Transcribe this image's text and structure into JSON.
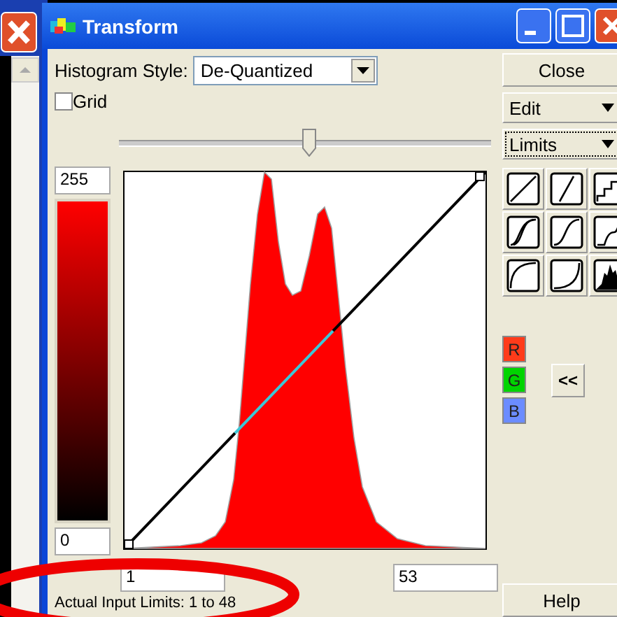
{
  "window": {
    "title": "Transform"
  },
  "histogram_style": {
    "label": "Histogram Style:",
    "value": "De-Quantized"
  },
  "grid": {
    "label": "Grid",
    "checked": false
  },
  "slider": {
    "level": 0.51
  },
  "output_max": "255",
  "output_min": "0",
  "input_min": "1",
  "input_max": "53",
  "status": "Actual Input Limits: 1 to 48",
  "close": "Close",
  "menus": [
    {
      "label": "Edit",
      "focused": false
    },
    {
      "label": "Limits",
      "focused": true
    }
  ],
  "presets": [
    {
      "kind": "linear"
    },
    {
      "kind": "steep"
    },
    {
      "kind": "steps"
    },
    {
      "kind": "s-curve"
    },
    {
      "kind": "s-soft"
    },
    {
      "kind": "step-curve"
    },
    {
      "kind": "log"
    },
    {
      "kind": "exp"
    },
    {
      "kind": "histogram"
    }
  ],
  "channels": [
    {
      "label": "R",
      "color": "#ff3b1a"
    },
    {
      "label": "G",
      "color": "#00d400"
    },
    {
      "label": "B",
      "color": "#6b8cff"
    }
  ],
  "collapse": "<<",
  "help": "Help"
}
